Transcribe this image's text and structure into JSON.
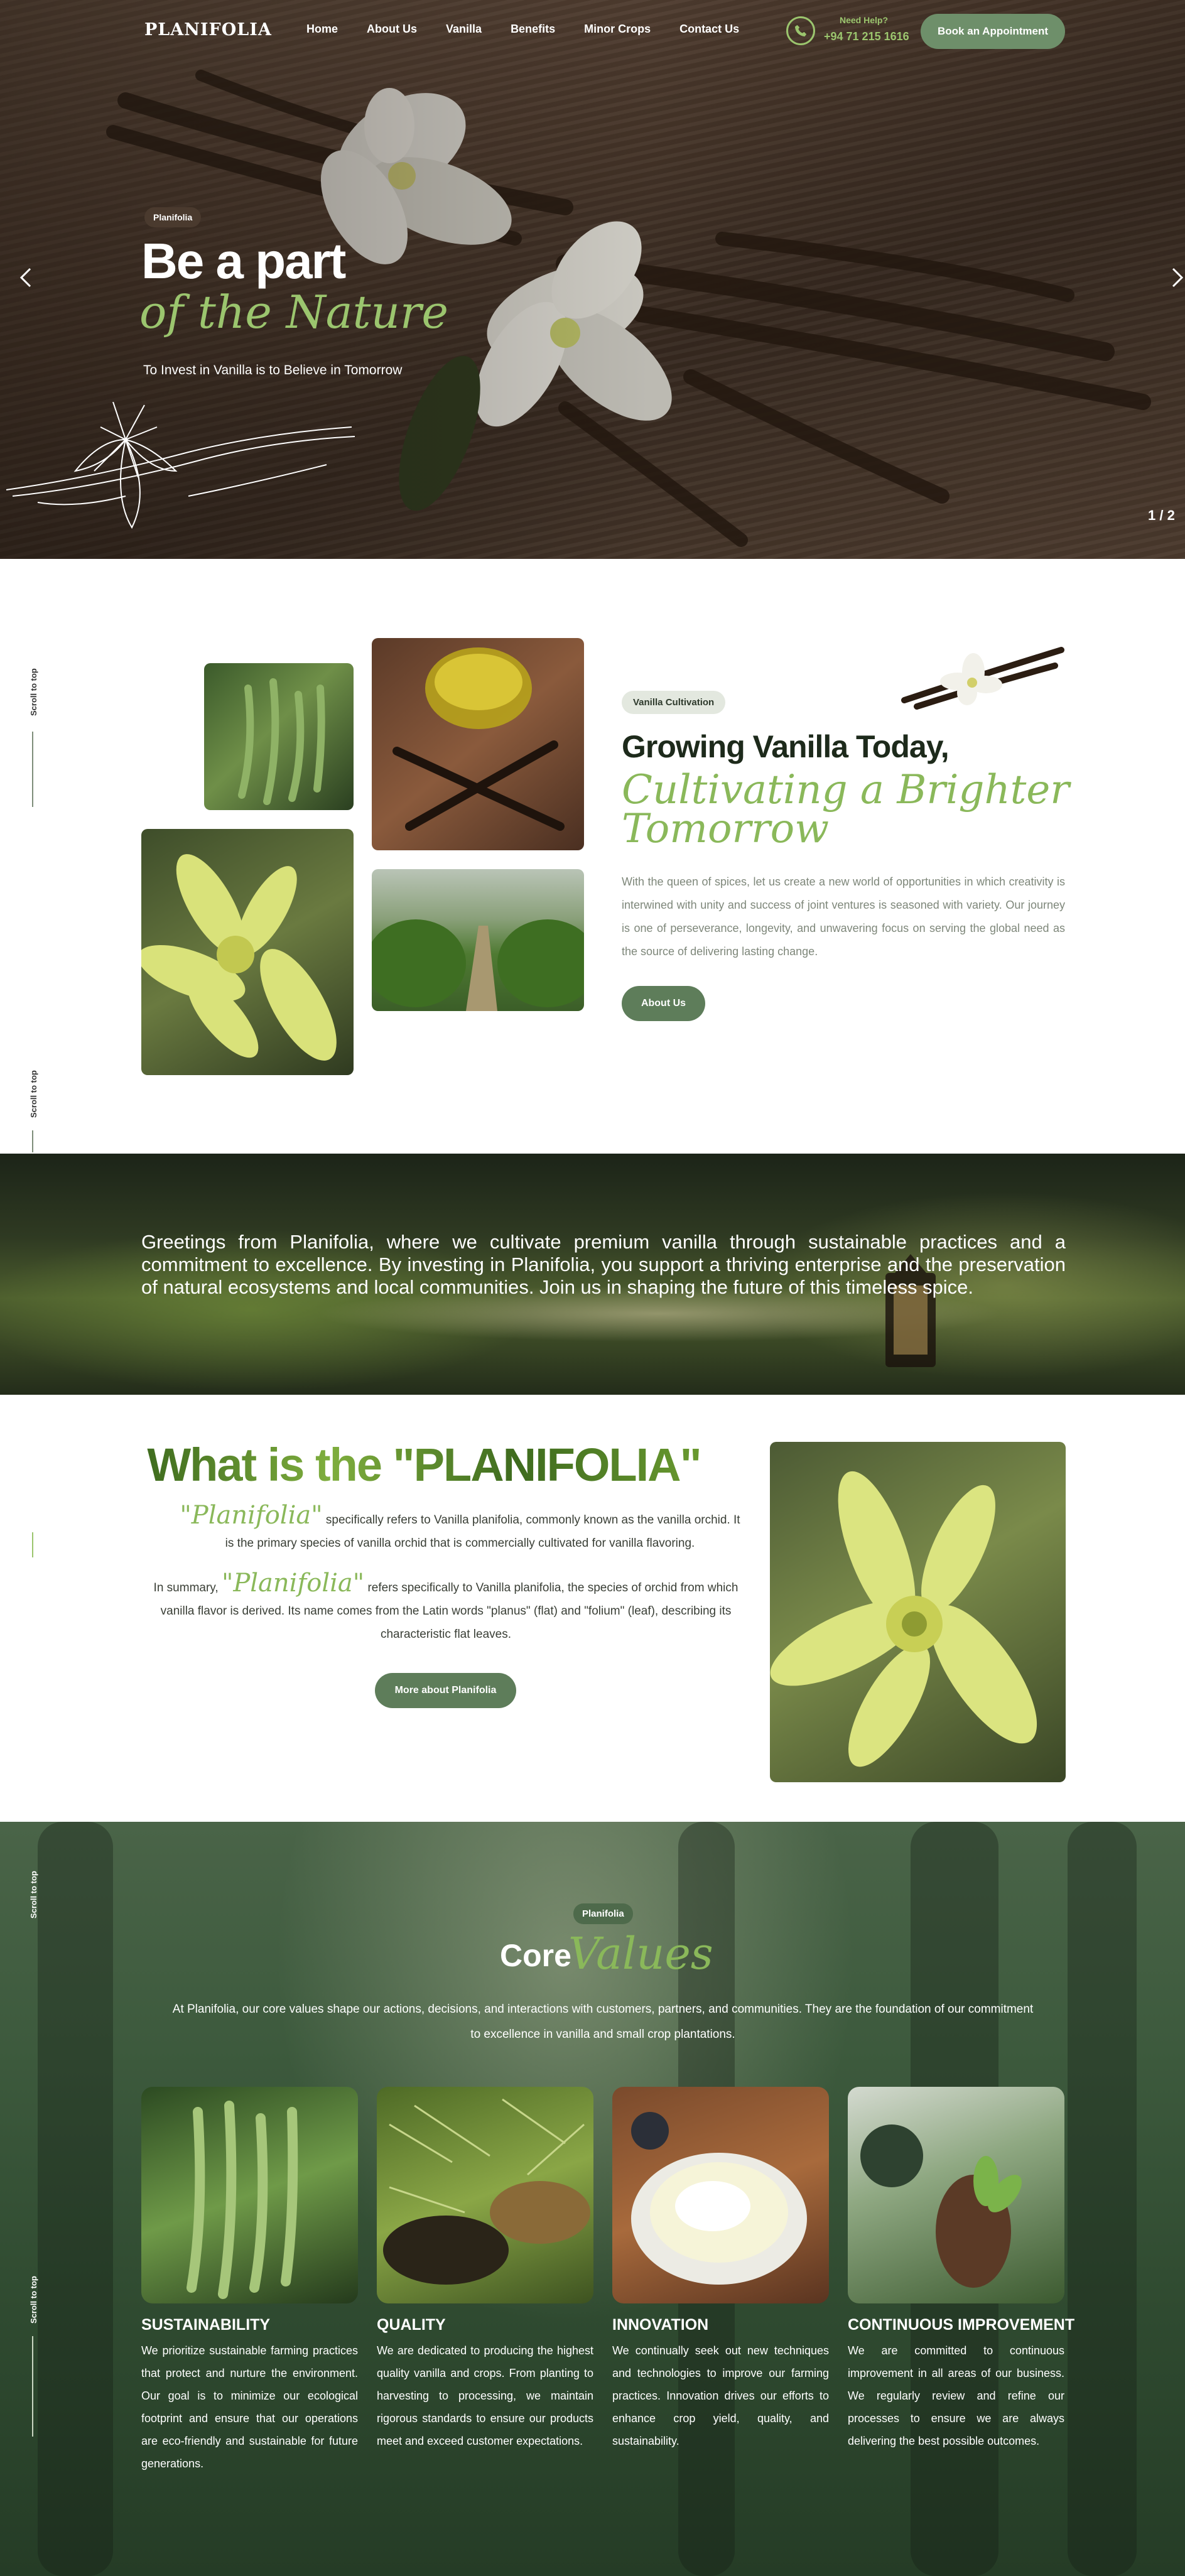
{
  "nav": {
    "logo": "PLANIFOLIA",
    "menu": [
      "Home",
      "About Us",
      "Vanilla",
      "Benefits",
      "Minor Crops",
      "Contact Us"
    ],
    "help_label": "Need Help?",
    "help_phone": "+94 71 215 1616",
    "book_button": "Book an Appointment"
  },
  "hero": {
    "badge": "Planifolia",
    "title": "Be a part",
    "script": "of the Nature",
    "subtitle": "To Invest in Vanilla is to Believe in Tomorrow",
    "pager": "1 / 2"
  },
  "scroll_top": {
    "label": "Scroll to top"
  },
  "about": {
    "badge": "Vanilla Cultivation",
    "title": "Growing Vanilla Today,",
    "script_line1": "Cultivating a Brighter",
    "script_line2": "Tomorrow",
    "paragraph": "With the queen of spices, let us create a new world of opportunities in which creativity is interwined with unity and success of joint ventures is seasoned with variety. Our journey is one of perseverance, longevity, and unwavering focus on serving the global need as the source of delivering lasting change.",
    "button": "About Us"
  },
  "banner": {
    "text": "Greetings from Planifolia, where we cultivate premium vanilla through sustainable practices and a commitment to excellence. By investing in Planifolia, you support a thriving enterprise and the preservation of natural ecosystems and local communities. Join us in shaping the future of this timeless spice."
  },
  "whatis": {
    "title": "What is the \"PLANIFOLIA\"",
    "p1_script": "\"Planifolia\"",
    "p1_text": " specifically refers to Vanilla planifolia, commonly known as the vanilla orchid. It is the primary species of vanilla orchid that is commercially cultivated for vanilla flavoring.",
    "p2_lead": "In summary, ",
    "p2_script": "\"Planifolia\"",
    "p2_text": " refers specifically to Vanilla planifolia, the species of orchid from which vanilla flavor is derived. Its name comes from the Latin words \"planus\" (flat) and \"folium\" (leaf), describing its characteristic flat leaves.",
    "button": "More about Planifolia"
  },
  "core_values": {
    "badge": "Planifolia",
    "title": "Core",
    "script": "Values",
    "paragraph": "At Planifolia, our core values shape our actions, decisions, and interactions with customers, partners, and communities. They are the foundation of our commitment to excellence in vanilla and small crop plantations.",
    "cards": [
      {
        "title": "SUSTAINABILITY",
        "text": "We prioritize sustainable farming practices that protect and nurture the environment. Our goal is to minimize our ecological footprint and ensure that our operations are eco-friendly and sustainable for future generations."
      },
      {
        "title": "QUALITY",
        "text": "We are dedicated to producing the highest quality vanilla and crops. From planting to harvesting to processing, we maintain rigorous standards to ensure our products meet and exceed customer expectations."
      },
      {
        "title": "INNOVATION",
        "text": "We continually seek out new techniques and technologies to improve our farming practices. Innovation drives our efforts to enhance crop yield, quality, and sustainability."
      },
      {
        "title": "CONTINUOUS IMPROVEMENT",
        "text": "We are committed to continuous improvement in all areas of our business. We regularly review and refine our processes to ensure we are always delivering the best possible outcomes."
      }
    ]
  },
  "colors": {
    "accent_green": "#8ab85a",
    "button_green": "#5e7d5a",
    "dark_text": "#1d2a1b"
  }
}
